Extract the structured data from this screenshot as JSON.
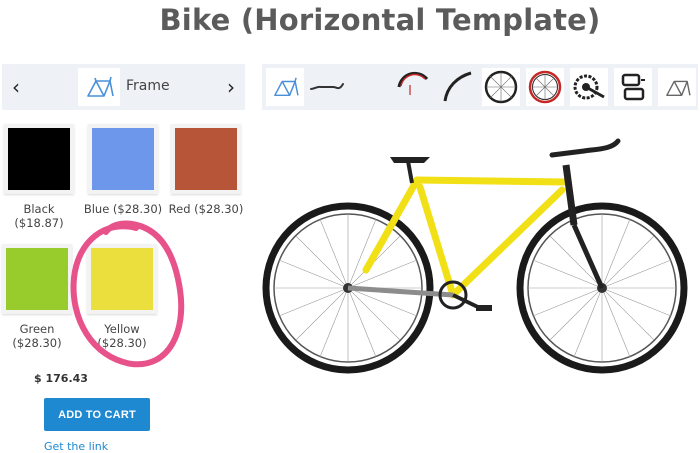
{
  "page": {
    "title": "Bike (Horizontal Template)"
  },
  "layer_nav": {
    "prev_icon": "chevron-left-icon",
    "next_icon": "chevron-right-icon",
    "current_layer": "Frame",
    "prev_glyph": "‹",
    "next_glyph": "›"
  },
  "options": [
    {
      "name": "Black",
      "price": "($18.87)",
      "label": "Black ($18.87)",
      "color": "#000000"
    },
    {
      "name": "Blue",
      "price": "($28.30)",
      "label": "Blue ($28.30)",
      "color": "#6c97ea"
    },
    {
      "name": "Red",
      "price": "($28.30)",
      "label": "Red ($28.30)",
      "color": "#b75538"
    },
    {
      "name": "Green",
      "price": "($28.30)",
      "label": "Green ($28.30)",
      "color": "#97cc2c"
    },
    {
      "name": "Yellow",
      "price": "($28.30)",
      "label": "Yellow ($28.30)",
      "color": "#ebdf3d"
    }
  ],
  "selected_option": "Yellow",
  "total_price": "$ 176.43",
  "actions": {
    "add_to_cart": "ADD TO CART",
    "get_link": "Get the link"
  },
  "toolbar": {
    "items": [
      "frame-icon",
      "handlebar-icon",
      "front-rim-icon",
      "rear-rim-icon",
      "front-wheel-icon",
      "rear-wheel-icon",
      "crankset-icon",
      "pedals-icon",
      "frame-outline-icon"
    ]
  },
  "colors": {
    "accent": "#1e88d1",
    "highlight_circle": "#e8528a",
    "frame_color": "#f2e017"
  }
}
